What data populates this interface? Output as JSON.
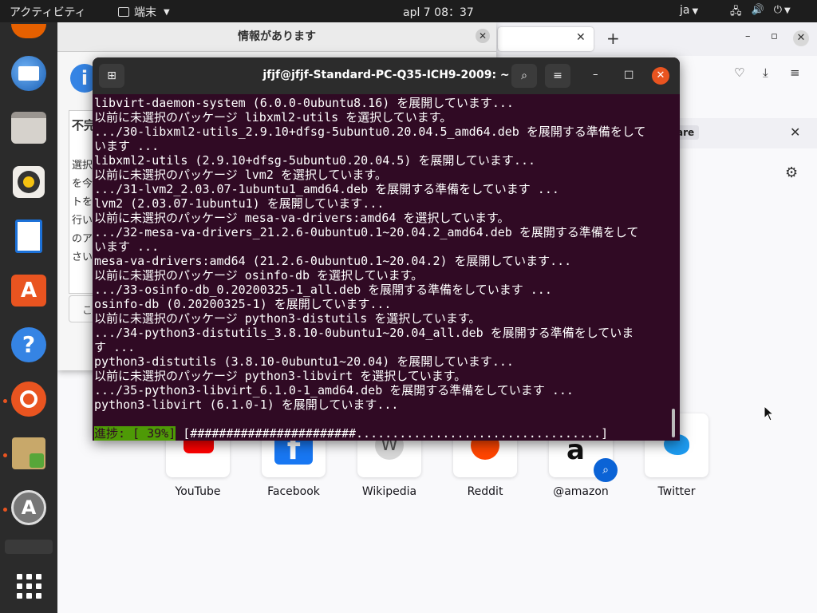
{
  "topbar": {
    "activities": "アクティビティ",
    "app_name": "端末",
    "clock": "apl 7  08：37",
    "lang": "ja",
    "tray_network": "⚙",
    "tray_volume": "🔊",
    "tray_power": "⏻"
  },
  "dock": {
    "items": [
      {
        "name": "thunderbird"
      },
      {
        "name": "files"
      },
      {
        "name": "rhythmbox"
      },
      {
        "name": "libreoffice-writer"
      },
      {
        "name": "ubuntu-software"
      },
      {
        "name": "help"
      },
      {
        "name": "ubuntu"
      },
      {
        "name": "installer"
      },
      {
        "name": "software-updater"
      }
    ]
  },
  "dialog": {
    "title": "情報があります",
    "heading_fragment": "不完",
    "lines": [
      "選択",
      "を今",
      "トを",
      "行い",
      "のア",
      "さい"
    ],
    "button_fragment": "こ"
  },
  "browser": {
    "notification_pill": "are",
    "top_sites": [
      {
        "label": "YouTube"
      },
      {
        "label": "Facebook"
      },
      {
        "label": "Wikipedia"
      },
      {
        "label": "Reddit"
      },
      {
        "label": "@amazon"
      },
      {
        "label": "Twitter"
      }
    ]
  },
  "terminal": {
    "title": "jfjf@jfjf-Standard-PC-Q35-ICH9-2009: ~",
    "lines": [
      "libvirt-daemon-system (6.0.0-0ubuntu8.16) を展開しています...",
      "以前に未選択のパッケージ libxml2-utils を選択しています。",
      ".../30-libxml2-utils_2.9.10+dfsg-5ubuntu0.20.04.5_amd64.deb を展開する準備をして",
      "います ...",
      "libxml2-utils (2.9.10+dfsg-5ubuntu0.20.04.5) を展開しています...",
      "以前に未選択のパッケージ lvm2 を選択しています。",
      ".../31-lvm2_2.03.07-1ubuntu1_amd64.deb を展開する準備をしています ...",
      "lvm2 (2.03.07-1ubuntu1) を展開しています...",
      "以前に未選択のパッケージ mesa-va-drivers:amd64 を選択しています。",
      ".../32-mesa-va-drivers_21.2.6-0ubuntu0.1~20.04.2_amd64.deb を展開する準備をして",
      "います ...",
      "mesa-va-drivers:amd64 (21.2.6-0ubuntu0.1~20.04.2) を展開しています...",
      "以前に未選択のパッケージ osinfo-db を選択しています。",
      ".../33-osinfo-db_0.20200325-1_all.deb を展開する準備をしています ...",
      "osinfo-db (0.20200325-1) を展開しています...",
      "以前に未選択のパッケージ python3-distutils を選択しています。",
      ".../34-python3-distutils_3.8.10-0ubuntu1~20.04_all.deb を展開する準備をしていま",
      "す ...",
      "python3-distutils (3.8.10-0ubuntu1~20.04) を展開しています...",
      "以前に未選択のパッケージ python3-libvirt を選択しています。",
      ".../35-python3-libvirt_6.1.0-1_amd64.deb を展開する準備をしています ...",
      "python3-libvirt (6.1.0-1) を展開しています..."
    ],
    "progress_label": "進捗: [ 39%]",
    "progress_bar": " [#######################..................................]",
    "progress_value": 0.39
  }
}
